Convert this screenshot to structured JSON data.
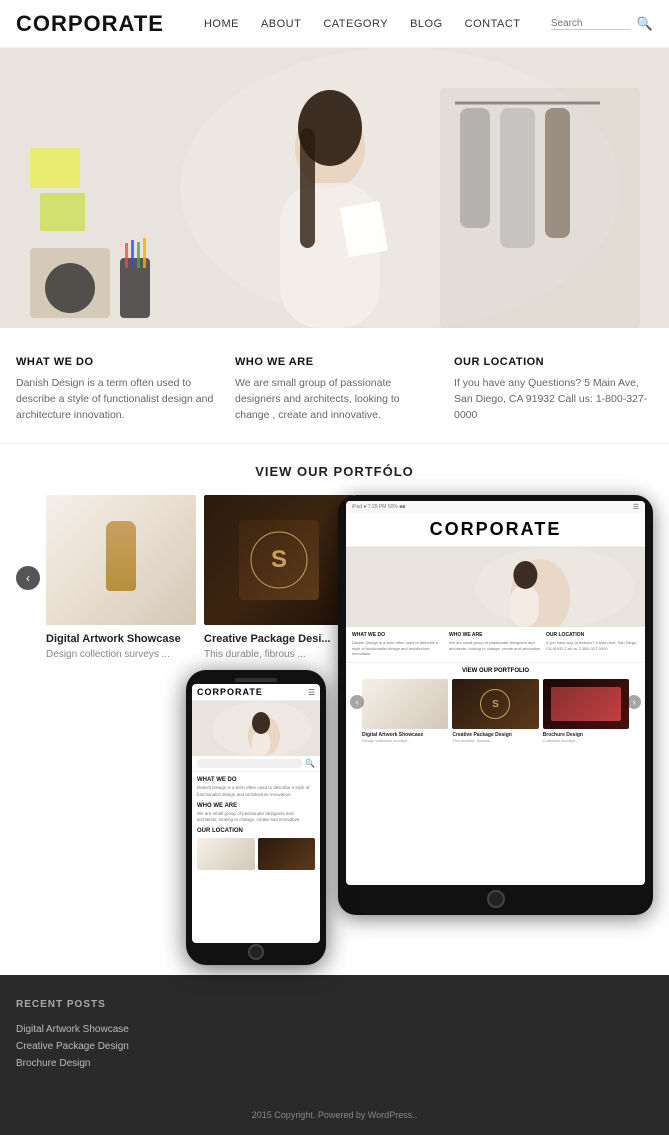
{
  "header": {
    "logo": "CORPORATE",
    "nav": [
      {
        "label": "HOME"
      },
      {
        "label": "ABOUT"
      },
      {
        "label": "CATEGORY"
      },
      {
        "label": "BLOG"
      },
      {
        "label": "CONTACT"
      }
    ],
    "search_placeholder": "Search"
  },
  "info_section": {
    "col1": {
      "title": "WHAT WE DO",
      "text": "Danish Design is a term often used to describe a style of functionalist design and architecture innovation."
    },
    "col2": {
      "title": "WHO WE ARE",
      "text": "We are small group of passionate designers and architects, looking to change , create and innovative."
    },
    "col3": {
      "title": "OUR LOCATION",
      "text": "If you have any Questions?\n5 Main Ave, San Diego, CA 91932\nCall us: 1-800-327-0000"
    }
  },
  "portfolio": {
    "title": "VIEW OUR PORTFÓLO",
    "arrow_left": "‹",
    "arrow_right": "›",
    "items": [
      {
        "title": "Digital Artwork Showcase",
        "desc": "Design collection surveys ..."
      },
      {
        "title": "Creative Package Desi...",
        "desc": "This durable, fibrous ..."
      }
    ]
  },
  "tablet": {
    "logo": "CORPORATE",
    "status_bar": "iPad ●  7:29 PM  50% ■■",
    "info": {
      "col1": {
        "title": "WHAT WE DO",
        "text": "Danish Design is a term often used to describe a style of functionalist design and architecture innovation."
      },
      "col2": {
        "title": "WHO WE ARE",
        "text": "We are small group of passionate designers and architects, looking to change, create and innovative."
      },
      "col3": {
        "title": "OUR LOCATION",
        "text": "If you have any Questions? 5 Main Ave, San Diego, CA 91932 Call us: 1-800-327-0000"
      }
    },
    "portfolio_title": "VIEW OUR PORTFOLIO",
    "items": [
      {
        "title": "Digital Artwork Showcase",
        "desc": "Design collection surveys..."
      },
      {
        "title": "Creative Package Design",
        "desc": "This durable. Nessus..."
      },
      {
        "title": "Brochure Design",
        "desc": "Collection surveys..."
      }
    ]
  },
  "mobile": {
    "logo": "CORPORATE",
    "sections": [
      {
        "title": "WHAT WE DO",
        "text": "Danish Design is a term often used to describe a style of functionalist design and architecture innovation."
      },
      {
        "title": "WHO WE ARE",
        "text": "We are small group of passionate designers and architects, looking to change, create and innovative."
      },
      {
        "title": "OUR LOCATION",
        "text": ""
      }
    ]
  },
  "sidebar": {
    "recent_posts_title": "RECENT POSTS",
    "posts": [
      {
        "label": "Digital Artwork Showcase"
      },
      {
        "label": "Creative Package Design"
      },
      {
        "label": "Brochure Design"
      }
    ]
  },
  "footer": {
    "text": "2015 Copyright. Powered by WordPress.."
  }
}
